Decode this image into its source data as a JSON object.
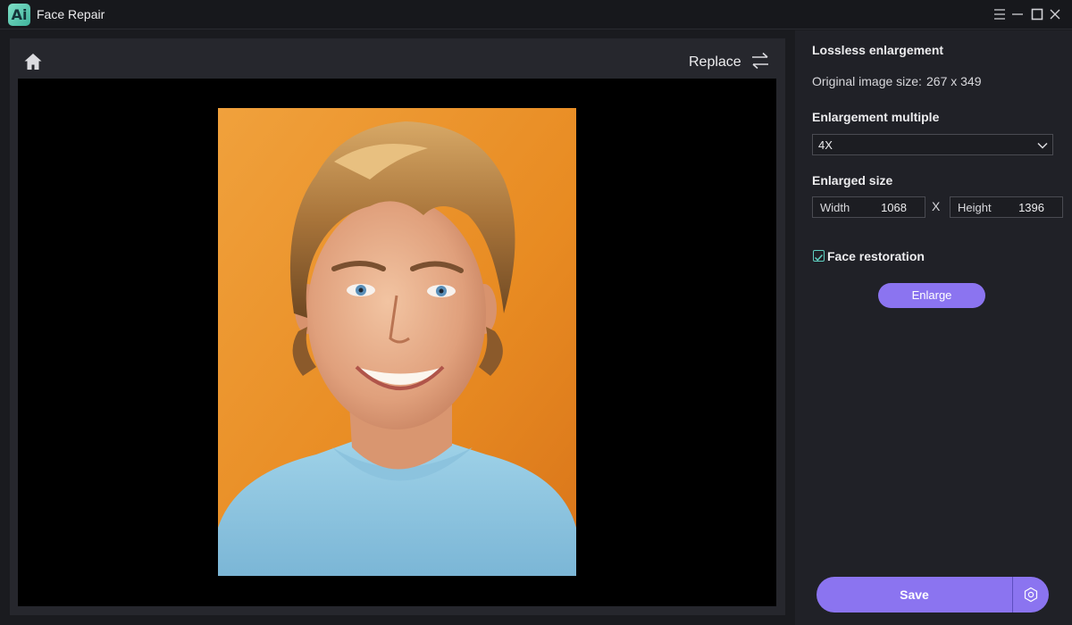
{
  "app": {
    "logo_text": "Ai",
    "title": "Face Repair"
  },
  "toolbar": {
    "replace_label": "Replace"
  },
  "panel": {
    "lossless_title": "Lossless enlargement",
    "original_size_label": "Original image size:",
    "original_size_value": "267 x 349",
    "multiple_title": "Enlargement multiple",
    "multiple_selected": "4X",
    "enlarged_title": "Enlarged size",
    "width_label": "Width",
    "width_value": "1068",
    "separator": "X",
    "height_label": "Height",
    "height_value": "1396",
    "face_restoration_label": "Face restoration",
    "face_restoration_checked": true,
    "enlarge_label": "Enlarge",
    "save_label": "Save"
  },
  "icons": {
    "home": "home-icon",
    "replace": "swap-arrows-icon",
    "menu": "hamburger-icon",
    "minimize": "minimize-icon",
    "maximize": "maximize-icon",
    "close": "close-icon",
    "dropdown": "chevron-down-icon",
    "checkbox": "checkmark-icon",
    "save_settings": "hexagon-settings-icon"
  },
  "colors": {
    "accent": "#8b74f0",
    "check": "#5fcfc0",
    "background": "#1a1b1f"
  }
}
